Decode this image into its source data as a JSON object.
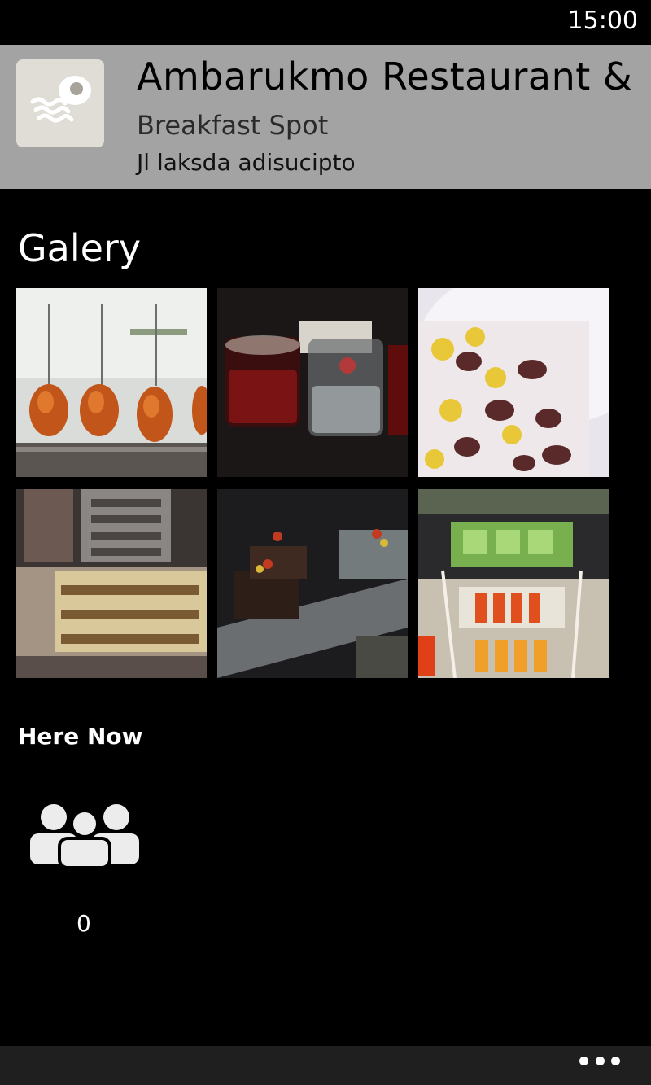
{
  "status_bar": {
    "time": "15:00"
  },
  "header": {
    "venue_name": "Ambarukmo Restaurant &",
    "category": "Breakfast Spot",
    "address": "Jl laksda adisucipto",
    "icon": "breakfast-bacon-egg-icon",
    "background_color": "#a3a3a3"
  },
  "gallery": {
    "title": "Galery",
    "photos": [
      {
        "name": "roast-chickens-photo"
      },
      {
        "name": "drink-glasses-photo"
      },
      {
        "name": "cereal-bowl-photo"
      },
      {
        "name": "display-case-photo"
      },
      {
        "name": "chocolate-desserts-photo"
      },
      {
        "name": "sushi-buffet-photo"
      }
    ]
  },
  "here_now": {
    "title": "Here Now",
    "icon": "people-icon",
    "count": "0"
  },
  "app_bar": {
    "more_icon": "ellipsis-icon"
  }
}
